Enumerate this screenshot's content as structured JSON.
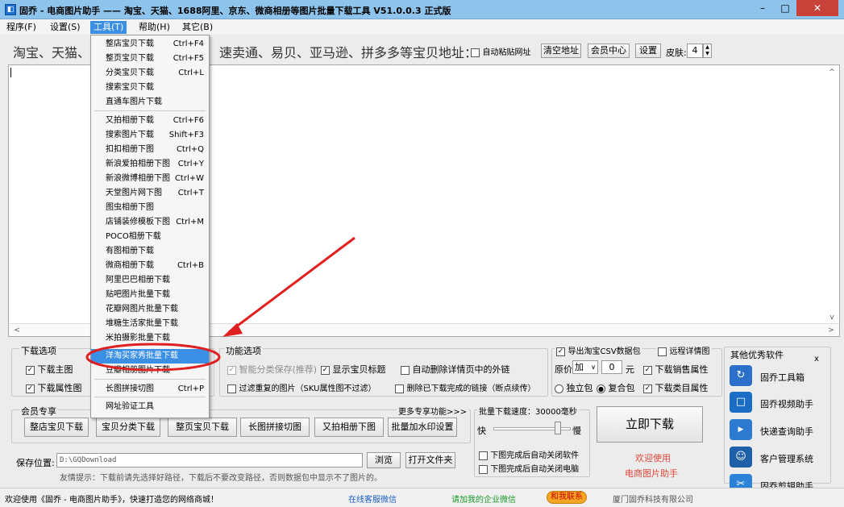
{
  "window": {
    "title": "固乔 - 电商图片助手 —— 淘宝、天猫、1688阿里、京东、微商相册等图片批量下载工具 V51.0.0.3 正式版",
    "min": "–",
    "max": "□",
    "close": "✕"
  },
  "menu": [
    "程序(F)",
    "设置(S)",
    "工具(T)",
    "帮助(H)",
    "其它(B)"
  ],
  "url_bar": {
    "label_left": "淘宝、天猫、",
    "label_right": "速卖通、易贝、亚马逊、拼多多等宝贝地址：",
    "auto_paste": "自动粘贴网址",
    "clear": "清空地址",
    "member": "会员中心",
    "settings": "设置",
    "skin_label": "皮肤:",
    "skin_value": "4"
  },
  "tools_menu": [
    {
      "label": "整店宝贝下载",
      "shortcut": "Ctrl+F4"
    },
    {
      "label": "整页宝贝下载",
      "shortcut": "Ctrl+F5"
    },
    {
      "label": "分类宝贝下载",
      "shortcut": "Ctrl+L"
    },
    {
      "label": "搜索宝贝下载",
      "shortcut": ""
    },
    {
      "label": "直通车图片下载",
      "shortcut": ""
    },
    {
      "label": "又拍相册下载",
      "shortcut": "Ctrl+F6"
    },
    {
      "label": "搜索图片下载",
      "shortcut": "Shift+F3"
    },
    {
      "label": "扣扣相册下图",
      "shortcut": "Ctrl+Q"
    },
    {
      "label": "新浪爱拍相册下图",
      "shortcut": "Ctrl+Y"
    },
    {
      "label": "新浪微博相册下图",
      "shortcut": "Ctrl+W"
    },
    {
      "label": "天堂图片网下图",
      "shortcut": "Ctrl+T"
    },
    {
      "label": "图虫相册下图",
      "shortcut": ""
    },
    {
      "label": "店铺装修模板下图",
      "shortcut": "Ctrl+M"
    },
    {
      "label": "POCO相册下载",
      "shortcut": ""
    },
    {
      "label": "有图相册下载",
      "shortcut": ""
    },
    {
      "label": "微商相册下载",
      "shortcut": "Ctrl+B"
    },
    {
      "label": "阿里巴巴相册下载",
      "shortcut": ""
    },
    {
      "label": "贴吧图片批量下载",
      "shortcut": ""
    },
    {
      "label": "花瓣网图片批量下载",
      "shortcut": ""
    },
    {
      "label": "堆糖生活家批量下载",
      "shortcut": ""
    },
    {
      "label": "米拍摄影批量下载",
      "shortcut": ""
    },
    {
      "label": "洋淘买家秀批量下载",
      "shortcut": ""
    },
    {
      "label": "豆瓣相册图片下载",
      "shortcut": ""
    },
    {
      "label": "长图拼接切图",
      "shortcut": "Ctrl+P"
    },
    {
      "label": "网址验证工具",
      "shortcut": ""
    }
  ],
  "download_options": {
    "title": "下载选项",
    "main": "下载主图",
    "attr": "下载属性图"
  },
  "function_options": {
    "title": "功能选项",
    "smart": "智能分类保存(推荐)",
    "show_title": "显示宝贝标题",
    "auto_del": "自动删除详情页中的外链",
    "filter_dup": "过滤重复的图片（SKU属性图不过滤）",
    "del_done": "删除已下载完成的链接（断点续传）"
  },
  "csv": {
    "export": "导出淘宝CSV数据包",
    "remote": "远程详情图",
    "price_label": "原价",
    "op": "加",
    "price_val": "0",
    "unit": "元",
    "sales_attr": "下载销售属性",
    "single": "独立包",
    "combined": "复合包",
    "category_attr": "下载类目属性"
  },
  "member": {
    "title": "会员专享",
    "more": "更多专享功能>>>",
    "buttons": [
      "整店宝贝下载",
      "宝贝分类下载",
      "整页宝贝下载",
      "长图拼接切图",
      "又拍相册下图",
      "批量加水印设置"
    ]
  },
  "speed": {
    "title": "批量下载速度：30000毫秒",
    "fast": "快",
    "slow": "慢",
    "close_soft": "下图完成后自动关闭软件",
    "close_pc": "下图完成后自动关闭电脑"
  },
  "download_btn": "立即下载",
  "welcome": {
    "line1": "欢迎使用",
    "line2": "电商图片助手"
  },
  "save": {
    "label": "保存位置:",
    "path": "D:\\GQDownload",
    "browse": "浏览",
    "open": "打开文件夹",
    "hint": "友情提示：下载前请先选择好路径，下载后不要改变路径，否则数据包中显示不了图片的。"
  },
  "side": {
    "title": "其他优秀软件",
    "close": "x",
    "items": [
      {
        "label": "固乔工具箱",
        "color": "#2a6fc9"
      },
      {
        "label": "固乔视频助手",
        "color": "#1a6cc4"
      },
      {
        "label": "快递查询助手",
        "color": "#2d7bd0"
      },
      {
        "label": "客户管理系统",
        "color": "#1d5fa8"
      },
      {
        "label": "固乔剪辑助手",
        "color": "#2b82d8"
      }
    ]
  },
  "status": {
    "left": "欢迎使用《固乔 - 电商图片助手》，快速打造您的网络商城！",
    "service": "在线客服微信",
    "partner": "请加我的企业微信",
    "contact": "和我联系",
    "company": "厦门固乔科技有限公司"
  },
  "colors": {
    "title_bar": "#8ec3ec",
    "highlight": "#3b8fe4",
    "annotation": "#e02020",
    "welcome": "#e0453a"
  }
}
